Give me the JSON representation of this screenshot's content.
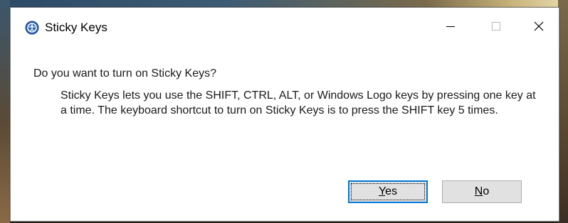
{
  "window": {
    "title": "Sticky Keys",
    "icon": "ease-of-access-icon",
    "controls": {
      "minimize": "minimize-icon",
      "maximize": "maximize-icon",
      "close": "close-icon"
    }
  },
  "content": {
    "question": "Do you want to turn on Sticky Keys?",
    "description": "Sticky Keys lets you use the SHIFT, CTRL, ALT, or Windows Logo keys by pressing one key at a time. The keyboard shortcut to turn on Sticky Keys is to press the SHIFT key 5 times."
  },
  "buttons": {
    "yes": {
      "accel": "Y",
      "rest": "es"
    },
    "no": {
      "accel": "N",
      "rest": "o"
    }
  },
  "colors": {
    "accent": "#0078d7",
    "button_bg": "#e1e1e1",
    "button_border": "#adadad"
  }
}
